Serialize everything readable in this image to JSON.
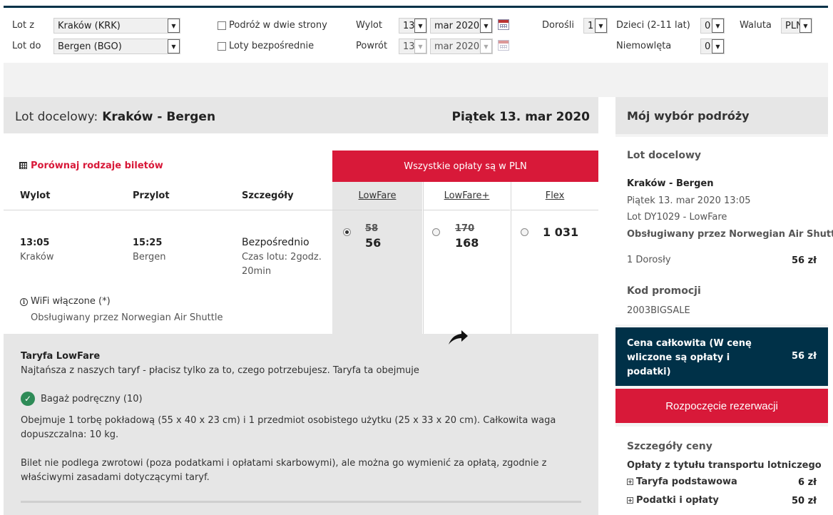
{
  "search": {
    "from_label": "Lot z",
    "from_value": "Kraków (KRK)",
    "to_label": "Lot do",
    "to_value": "Bergen (BGO)",
    "roundtrip_label": "Podróż w dwie strony",
    "direct_label": "Loty bezpośrednie",
    "depart_label": "Wylot",
    "depart_day": "13",
    "depart_month": "mar 2020",
    "return_label": "Powrót",
    "return_day": "13",
    "return_month": "mar 2020",
    "adults_label": "Dorośli",
    "adults_value": "1",
    "children_label": "Dzieci (2-11 lat)",
    "children_value": "0",
    "infants_label": "Niemowlęta",
    "infants_value": "0",
    "currency_label": "Waluta",
    "currency_value": "PLN"
  },
  "flight": {
    "header_label": "Lot docelowy:",
    "header_route": "Kraków - Bergen",
    "header_date": "Piątek 13. mar 2020",
    "compare_link": "Porównaj rodzaje biletów",
    "col_depart": "Wylot",
    "col_arrive": "Przylot",
    "col_details": "Szczegóły",
    "depart_time": "13:05",
    "depart_city": "Kraków",
    "arrive_time": "15:25",
    "arrive_city": "Bergen",
    "detail_type": "Bezpośrednio",
    "detail_duration_1": "Czas lotu: 2godz.",
    "detail_duration_2": "20min",
    "wifi": "WiFi włączone (*)",
    "operated_by": "Obsługiwany przez Norwegian Air Shuttle"
  },
  "fares": {
    "banner": "Wszystkie opłaty są w PLN",
    "lowfare": {
      "name": "LowFare",
      "old": "58",
      "price": "56"
    },
    "lowfareplus": {
      "name": "LowFare+",
      "old": "170",
      "price": "168"
    },
    "flex": {
      "name": "Flex",
      "price": "1 031"
    }
  },
  "fare_details": {
    "title": "Taryfa LowFare",
    "intro": "Najtańsza z naszych taryf - płacisz tylko za to, czego potrzebujesz. Taryfa ta obejmuje",
    "bag_label": "Bagaż podręczny (10)",
    "bag_text": "Obejmuje 1 torbę pokładową (55 x 40 x 23 cm) i 1 przedmiot osobistego użytku (25 x 33 x 20 cm). Całkowita waga dopuszczalna: 10 kg.",
    "refund_text": "Bilet nie podlega zwrotowi (poza podatkami i opłatami skarbowymi), ale można go wymienić za opłatą, zgodnie z właściwymi zasadami dotyczącymi taryf."
  },
  "summary": {
    "title": "Mój wybór podróży",
    "outbound_label": "Lot docelowy",
    "route": "Kraków - Bergen",
    "datetime": "Piątek 13. mar 2020 13:05",
    "flight_no": "Lot DY1029 - LowFare",
    "operated": "Obsługiwany przez Norwegian Air Shuttle",
    "pax": "1 Dorosły",
    "pax_price": "56 zł",
    "promo_label": "Kod promocji",
    "promo_code": "2003BIGSALE",
    "total_label": "Cena całkowita (W cenę wliczone są opłaty i podatki)",
    "total_amount": "56 zł",
    "book_button": "Rozpoczęcie rezerwacji",
    "price_details_label": "Szczegóły ceny",
    "transport_fees": "Opłaty z tytułu transportu lotniczego",
    "base_fare_label": "Taryfa podstawowa",
    "base_fare_value": "6 zł",
    "taxes_label": "Podatki i opłaty",
    "taxes_value": "50 zł"
  }
}
